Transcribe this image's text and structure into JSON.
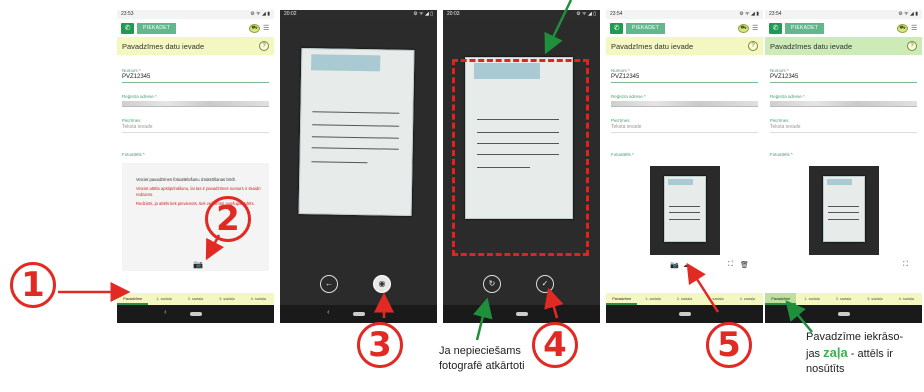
{
  "screens": [
    {
      "time": "23:53",
      "status_icons": "⚙ ᯤ ◢ ▮",
      "call_label": "PIEKADET",
      "title": "Pavadzīmes datu ievade",
      "number_label": "Numurs *",
      "number_value": "PVZ12345",
      "address_label": "Reģistra adrese *",
      "note_label": "Piezīmes",
      "note_placeholder": "Teksta ievade",
      "photos_label": "Fotoattēls *",
      "instructions": [
        "Veiciet pavadzīmes fotoattēlošanu izrakstīšanas brīdī.",
        "Veiciet attēla apstiprināšanu, lai tas ir pavadzīmes numurs ir skaidri redzams.",
        "Redziets, ja attēls tiek pievienots, tiek veiksmīgi augšupielādēts."
      ],
      "tabs": [
        "Pavadzīme",
        "1. sadaļa",
        "2. sadaļa",
        "3. sadaļa",
        "4. sadaļa"
      ]
    },
    {
      "time": "20:02",
      "status_icons": "⚙ ᯤ ◢ ▯"
    },
    {
      "time": "20:03",
      "status_icons": "⚙ ᯤ ◢ ▯"
    },
    {
      "time": "23:54",
      "status_icons": "⚙ ᯤ ◢ ▮",
      "call_label": "PIEKADET",
      "title": "Pavadzīmes datu ievade",
      "number_label": "Numurs *",
      "number_value": "PVZ12345",
      "address_label": "Reģistra adrese *",
      "note_label": "Piezīmes",
      "note_placeholder": "Teksta ievade",
      "photos_label": "Fotoattēls *",
      "tabs": [
        "Pavadzīme",
        "1. sadaļa",
        "2. sadaļa",
        "3. sadaļa",
        "4. sadaļa"
      ]
    },
    {
      "time": "23:54",
      "status_icons": "⚙ ᯤ ◢ ▮",
      "call_label": "PIEKADET",
      "title": "Pavadzīmes datu ievade",
      "number_label": "Numurs *",
      "number_value": "PVZ12345",
      "address_label": "Reģistra adrese *",
      "note_label": "Piezīmes",
      "note_placeholder": "Teksta ievade",
      "photos_label": "Fotoattēls *",
      "tabs": [
        "Pavadzīme",
        "1. sadaļa",
        "2. sadaļa",
        "3. sadaļa",
        "4. sadaļa"
      ]
    }
  ],
  "callouts": {
    "c1": "1",
    "c2": "2",
    "c3": "3",
    "c4": "4",
    "c5": "5"
  },
  "captions": {
    "retake_line1": "Ja nepieciešams",
    "retake_line2": "fotografē atkārtoti",
    "green_line1": "Pavadzīme iekrāso-",
    "green_line2_pre": "jas ",
    "green_word": "zaļa",
    "green_line2_post": " - attēls ir",
    "green_line3": "nosūtīts"
  },
  "colors": {
    "callout_red": "#e22a24",
    "arrow_green": "#1f8f3c",
    "accent_green": "#2d8c4f",
    "title_yellow": "#f4f7bf"
  }
}
